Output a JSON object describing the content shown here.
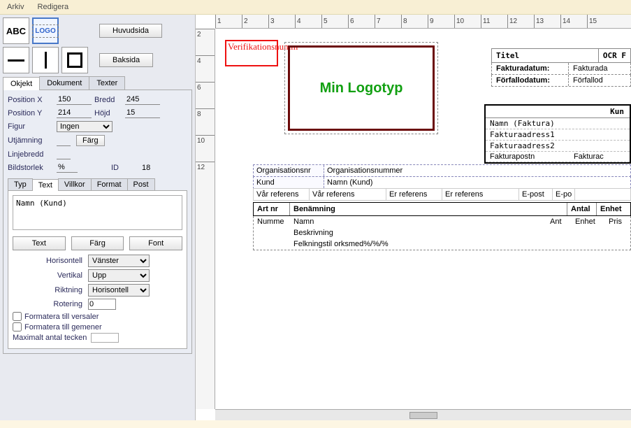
{
  "menu": {
    "file": "Arkiv",
    "edit": "Redigera"
  },
  "tools": {
    "abc": "ABC",
    "logo": "LOGO"
  },
  "side_buttons": {
    "main": "Huvudsida",
    "back": "Baksida"
  },
  "tabs": {
    "object": "Okjekt",
    "document": "Dokument",
    "texts": "Texter"
  },
  "props": {
    "posx_lbl": "Position X",
    "posx": "150",
    "posy_lbl": "Position Y",
    "posy": "214",
    "width_lbl": "Bredd",
    "width": "245",
    "height_lbl": "Höjd",
    "height": "15",
    "figure_lbl": "Figur",
    "figure": "Ingen",
    "align_lbl": "Utjämning",
    "align": "",
    "lw_lbl": "Linjebredd",
    "lw": "",
    "imgsize_lbl": "Bildstorlek",
    "imgsize": "%",
    "id_lbl": "ID",
    "id": "18",
    "color_btn": "Färg"
  },
  "subtabs": {
    "type": "Typ",
    "text": "Text",
    "villkor": "Villkor",
    "format": "Format",
    "post": "Post"
  },
  "textarea": "Namn (Kund)",
  "text_btns": {
    "text": "Text",
    "color": "Färg",
    "font": "Font"
  },
  "text_props": {
    "h_lbl": "Horisontell",
    "h": "Vänster",
    "v_lbl": "Vertikal",
    "v": "Upp",
    "dir_lbl": "Riktning",
    "dir": "Horisontell",
    "rot_lbl": "Rotering",
    "rot": "0",
    "upper": "Formatera till versaler",
    "lower": "Formatera till gemener",
    "maxch_lbl": "Maximalt antal tecken"
  },
  "canvas": {
    "ruler_h": [
      "1",
      "2",
      "3",
      "4",
      "5",
      "6",
      "7",
      "8",
      "9",
      "10",
      "11",
      "12",
      "13",
      "14",
      "15"
    ],
    "ruler_v": [
      "2",
      "4",
      "6",
      "8",
      "10",
      "12"
    ],
    "verif": "Verifikationsnumm",
    "logo": "Min Logotyp",
    "titel": "Titel",
    "ocr": "OCR F",
    "fdate_lbl": "Fakturadatum:",
    "fdate": "Fakturada",
    "ddate_lbl": "Förfallodatum:",
    "ddate": "Förfallod",
    "kun": "Kun",
    "kund_rows": [
      "Namn (Faktura)",
      "Fakturaadress1",
      "Fakturaadress2"
    ],
    "kund_last1": "Fakturapostn",
    "kund_last2": "Fakturac",
    "orgnr_lbl": "Organisationsnr",
    "orgnr": "Organisationsnummer",
    "kund_lbl": "Kund",
    "kund_val": "Namn (Kund)",
    "vref_lbl": "Vår referens",
    "vref": "Vår referens",
    "eref_lbl": "Er referens",
    "eref": "Er referens",
    "epost_lbl": "E-post",
    "epost": "E-po",
    "th_art": "Art nr",
    "th_ben": "Benämning",
    "th_ant": "Antal",
    "th_enh": "Enhet",
    "tr_num": "Numme",
    "tr_namn": "Namn",
    "tr_ant": "Ant",
    "tr_enh": "Enhet",
    "tr_pris": "Pris",
    "tr_besk": "Beskrivning",
    "tr_rab": "Felkningstil orksmed%/%/%"
  }
}
